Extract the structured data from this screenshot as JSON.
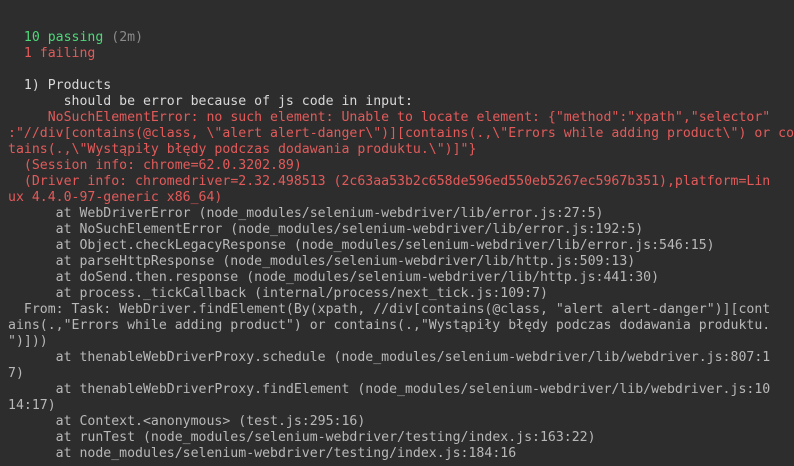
{
  "summary": {
    "passing_count": "10 passing",
    "passing_time": "(2m)",
    "failing_count": "1 failing"
  },
  "failure": {
    "title": "1) Products",
    "test_name": "should be error because of js code in input:",
    "error_lines": [
      "NoSuchElementError: no such element: Unable to locate element: {\"method\":\"xpath\",\"selector\"",
      ":\"//div[contains(@class, \\\"alert alert-danger\\\")][contains(.,\\\"Errors while adding product\\\") or con",
      "tains(.,\\\"Wystąpiły błędy podczas dodawania produktu.\\\")]\"}",
      "(Session info: chrome=62.0.3202.89)",
      "(Driver info: chromedriver=2.32.498513 (2c63aa53b2c658de596ed550eb5267ec5967b351),platform=Lin",
      "ux 4.4.0-97-generic x86_64)"
    ],
    "stack_lines": [
      "at WebDriverError (node_modules/selenium-webdriver/lib/error.js:27:5)",
      "at NoSuchElementError (node_modules/selenium-webdriver/lib/error.js:192:5)",
      "at Object.checkLegacyResponse (node_modules/selenium-webdriver/lib/error.js:546:15)",
      "at parseHttpResponse (node_modules/selenium-webdriver/lib/http.js:509:13)",
      "at doSend.then.response (node_modules/selenium-webdriver/lib/http.js:441:30)",
      "at process._tickCallback (internal/process/next_tick.js:109:7)"
    ],
    "from_task_lines": [
      "From: Task: WebDriver.findElement(By(xpath, //div[contains(@class, \"alert alert-danger\")][cont",
      "ains(.,\"Errors while adding product\") or contains(.,\"Wystąpiły błędy podczas dodawania produktu.",
      "\")]))"
    ],
    "stack_lines_2": [
      "at thenableWebDriverProxy.schedule (node_modules/selenium-webdriver/lib/webdriver.js:807:1",
      "7)",
      "at thenableWebDriverProxy.findElement (node_modules/selenium-webdriver/lib/webdriver.js:10",
      "14:17)",
      "at Context.<anonymous> (test.js:295:16)",
      "at runTest (node_modules/selenium-webdriver/testing/index.js:163:22)",
      "at node_modules/selenium-webdriver/testing/index.js:184:16"
    ]
  }
}
